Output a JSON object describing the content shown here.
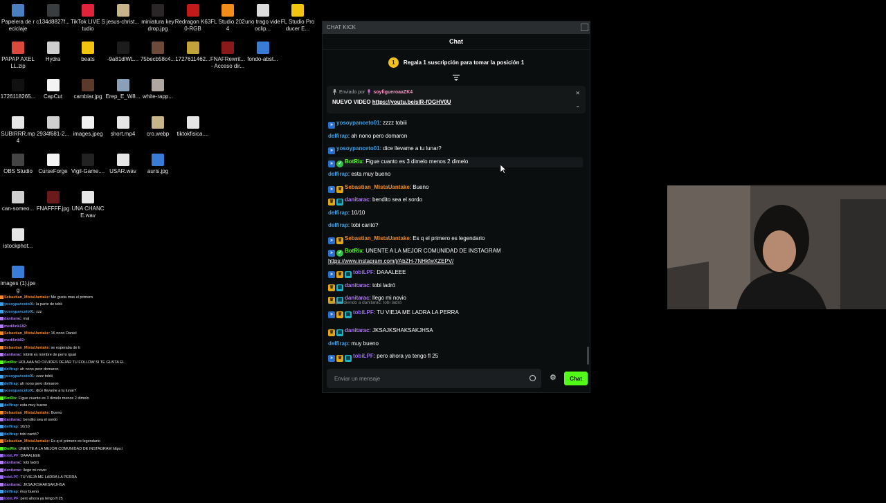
{
  "desktop_icons": [
    {
      "label": "Papelera de reciclaje",
      "color": "#4a7fc0"
    },
    {
      "label": "c134d8827f...",
      "color": "#3a3d40"
    },
    {
      "label": "TikTok LIVE Studio",
      "color": "#e0243a"
    },
    {
      "label": "jesus-christ...",
      "color": "#c7b48a"
    },
    {
      "label": "miniatura keydrop.jpg",
      "color": "#2a2526"
    },
    {
      "label": "Redragon K630-RGB",
      "color": "#c2191a"
    },
    {
      "label": "FL Studio 2024",
      "color": "#f28d1b"
    },
    {
      "label": "uno trago videoclip...",
      "color": "#dcdcdc"
    },
    {
      "label": "FL Studio Producer E...",
      "color": "#f1c40f"
    },
    {
      "label": "PAPAP AXELLL.zip",
      "color": "#d94a3c"
    },
    {
      "label": "Hydra",
      "color": "#cfcfcf"
    },
    {
      "label": "beats",
      "color": "#f1c40f"
    },
    {
      "label": "-9a81dlWL...",
      "color": "#1c1c1c"
    },
    {
      "label": "75becb58c4...",
      "color": "#6b4a3a"
    },
    {
      "label": "1727611462...",
      "color": "#c2a23a"
    },
    {
      "label": "FNAFRewrit... - Acceso dir...",
      "color": "#8a1a1a"
    },
    {
      "label": "fondo-abst...",
      "color": "#3a7bd5"
    },
    {
      "label": "1726118265...",
      "color": "#111111"
    },
    {
      "label": "CapCut",
      "color": "#f4f4f4"
    },
    {
      "label": "cambiar.jpg",
      "color": "#5a3a2a"
    },
    {
      "label": "Erep_E_W8...",
      "color": "#8aa0b8"
    },
    {
      "label": "white-rapp...",
      "color": "#b0a8a0"
    },
    {
      "label": "SUBIRRR.mp4",
      "color": "#e6e6e6"
    },
    {
      "label": "2934f681-2...",
      "color": "#d0d0d0"
    },
    {
      "label": "images.jpeg",
      "color": "#f0f0f0"
    },
    {
      "label": "short.mp4",
      "color": "#e6e6e6"
    },
    {
      "label": "cro.webp",
      "color": "#c7b48a"
    },
    {
      "label": "tiktokfisica....",
      "color": "#e6e6e6"
    },
    {
      "label": "OBS Studio",
      "color": "#444444"
    },
    {
      "label": "CurseForge",
      "color": "#f4f4f4"
    },
    {
      "label": "Vigil-Game....",
      "color": "#222222"
    },
    {
      "label": "USAR.wav",
      "color": "#e6e6e6"
    },
    {
      "label": "auris.jpg",
      "color": "#3a7bd5"
    },
    {
      "label": "can-someo...",
      "color": "#cfcfcf"
    },
    {
      "label": "FNAFFFF.jpg",
      "color": "#6a1a1a"
    },
    {
      "label": "UNA CHANCE.wav",
      "color": "#e6e6e6"
    },
    {
      "label": "istockphot...",
      "color": "#e6e6e6"
    },
    {
      "label": "images (1).jpeg",
      "color": "#3a7bd5"
    }
  ],
  "overlay_chat": [
    {
      "user": "Sebastian_MistaUantake",
      "text": ": Me gusta mas el primero",
      "color": "#f08a24"
    },
    {
      "user": "yosoypanceto01",
      "text": ": la parte de tobii",
      "color": "#3ea0e6"
    },
    {
      "user": "yosoypanceto01",
      "text": ": zzz",
      "color": "#3ea0e6"
    },
    {
      "user": "danitarac",
      "text": ": mal",
      "color": "#b07cf0"
    },
    {
      "user": "medilink182",
      "text": ": ",
      "color": "#b07cf0"
    },
    {
      "user": "Sebastian_MistaUantake",
      "text": ": 16 nooo Daniel",
      "color": "#f08a24"
    },
    {
      "user": "medilink82",
      "text": ": ",
      "color": "#b07cf0"
    },
    {
      "user": "Sebastian_MistaUantake",
      "text": ": se esperaba de ti",
      "color": "#f08a24"
    },
    {
      "user": "danitarac",
      "text": ": tobiiiii es nombre de perro igual",
      "color": "#b07cf0"
    },
    {
      "user": "BotRix",
      "text": ": HOLAAA NO OLVIDES DEJAR TU FOLLOW SI TE GUSTA EL",
      "color": "#53fc18"
    },
    {
      "user": "delfirap",
      "text": ": ah nono pero domaron",
      "color": "#3ea0e6"
    },
    {
      "user": "yosoypanceto01",
      "text": ": zzzz tobiii",
      "color": "#3ea0e6"
    },
    {
      "user": "delfirap",
      "text": ": ah nono pero domaron",
      "color": "#3ea0e6"
    },
    {
      "user": "yosoypanceto01",
      "text": ": dice llevame a tu lunar?",
      "color": "#3ea0e6"
    },
    {
      "user": "BotRix",
      "text": ": Figue cuanto es 3 dimelo menos 2 dimelo",
      "color": "#53fc18"
    },
    {
      "user": "delfirap",
      "text": ": esta muy bueno",
      "color": "#3ea0e6"
    },
    {
      "user": "Sebastian_MistaUantake",
      "text": ": Bueno",
      "color": "#f08a24"
    },
    {
      "user": "danitarac",
      "text": ": bendito sea el sordo",
      "color": "#b07cf0"
    },
    {
      "user": "delfirap",
      "text": ": 10/10",
      "color": "#3ea0e6"
    },
    {
      "user": "delfirap",
      "text": ": tobi cantó?",
      "color": "#3ea0e6"
    },
    {
      "user": "Sebastian_MistaUantake",
      "text": ": Es q el primero es legendario",
      "color": "#f08a24"
    },
    {
      "user": "BotRix",
      "text": ": UNENTE A LA MEJOR COMUNIDAD DE INSTAGRAM https:/",
      "color": "#53fc18"
    },
    {
      "user": "tobiLPF",
      "text": ": DAAALEEE",
      "color": "#9a6cf0"
    },
    {
      "user": "danitarac",
      "text": ": tobi ladró",
      "color": "#b07cf0"
    },
    {
      "user": "danitarac",
      "text": ": llego mi novio",
      "color": "#b07cf0"
    },
    {
      "user": "tobiLPF",
      "text": ": TU VIEJA ME LADRA LA PERRA",
      "color": "#9a6cf0"
    },
    {
      "user": "danitarac",
      "text": ": JKSAJKSHAKSAKJHSA",
      "color": "#b07cf0"
    },
    {
      "user": "delfirap",
      "text": ": muy bueno",
      "color": "#3ea0e6"
    },
    {
      "user": "tobiLPF",
      "text": ": pero ahora ya tengo fl 25",
      "color": "#9a6cf0"
    }
  ],
  "chat_window": {
    "title": "CHAT KICK",
    "header": "Chat",
    "subscription_prompt": "Regala 1 suscripción para tomar la posición 1",
    "coin_number": "1",
    "pinned": {
      "sent_by_label": "Enviado por",
      "user": "soyfigueroaaZK4",
      "message_prefix": "NUEVO VIDEO ",
      "link": "https://youtu.be/slR-fOGHV0U"
    },
    "messages": [
      {
        "user": "yosoypanceto01",
        "text": ": zzzz tobiii",
        "color": "#3ea0e6",
        "badges": [
          "mod"
        ]
      },
      {
        "user": "delfirap",
        "text": ": ah nono pero domaron",
        "color": "#3ea0e6",
        "badges": []
      },
      {
        "user": "yosoypanceto01",
        "text": ": dice llevame a tu lunar?",
        "color": "#3ea0e6",
        "badges": [
          "mod"
        ]
      },
      {
        "user": "BotRix",
        "text": ": Figue cuanto es 3 dimelo menos 2 dimelo",
        "color": "#53fc18",
        "badges": [
          "mod",
          "verified"
        ],
        "highlight": true
      },
      {
        "user": "delfirap",
        "text": ": esta muy bueno",
        "color": "#3ea0e6",
        "badges": []
      },
      {
        "user": "Sebastian_MistaUantake",
        "text": ": Bueno",
        "color": "#f08a24",
        "badges": [
          "mod",
          "crown"
        ]
      },
      {
        "user": "danitarac",
        "text": ": bendito sea el sordo",
        "color": "#b07cf0",
        "badges": [
          "crown",
          "sub"
        ]
      },
      {
        "user": "delfirap",
        "text": ": 10/10",
        "color": "#3ea0e6",
        "badges": []
      },
      {
        "user": "delfirap",
        "text": ": tobi cantó?",
        "color": "#3ea0e6",
        "badges": []
      },
      {
        "user": "Sebastian_MistaUantake",
        "text": ": Es q el primero es legendario",
        "color": "#f08a24",
        "badges": [
          "mod",
          "crown"
        ]
      },
      {
        "user": "BotRix",
        "text": ": UNENTE A LA MEJOR COMUNIDAD DE INSTAGRAM",
        "link": "https://www.instagram.com/j/AbZH-7NHkfwXZEPV/",
        "color": "#53fc18",
        "badges": [
          "mod",
          "verified"
        ]
      },
      {
        "user": "tobiLPF",
        "text": ": DAAALEEE",
        "color": "#9a6cf0",
        "badges": [
          "mod",
          "crown",
          "sub"
        ]
      },
      {
        "user": "danitarac",
        "text": ": tobi ladró",
        "color": "#b07cf0",
        "badges": [
          "crown",
          "sub"
        ]
      },
      {
        "user": "danitarac",
        "text": ": llego mi novio",
        "color": "#b07cf0",
        "badges": [
          "crown",
          "sub"
        ]
      },
      {
        "reply": "Respondiendo a danitarac: tobi ladró",
        "user": "tobiLPF",
        "text": ": TU VIEJA ME LADRA LA PERRA",
        "color": "#9a6cf0",
        "badges": [
          "mod",
          "crown",
          "sub"
        ]
      },
      {
        "user": "danitarac",
        "text": ": JKSAJKSHAKSAKJHSA",
        "color": "#b07cf0",
        "badges": [
          "crown",
          "sub"
        ]
      },
      {
        "user": "delfirap",
        "text": ": muy bueno",
        "color": "#3ea0e6",
        "badges": []
      },
      {
        "user": "tobiLPF",
        "text": ": pero ahora ya tengo fl 25",
        "color": "#9a6cf0",
        "badges": [
          "mod",
          "crown",
          "sub"
        ]
      }
    ],
    "input_placeholder": "Enviar un mensaje",
    "send_label": "Chat",
    "accent_color": "#53fc18"
  }
}
